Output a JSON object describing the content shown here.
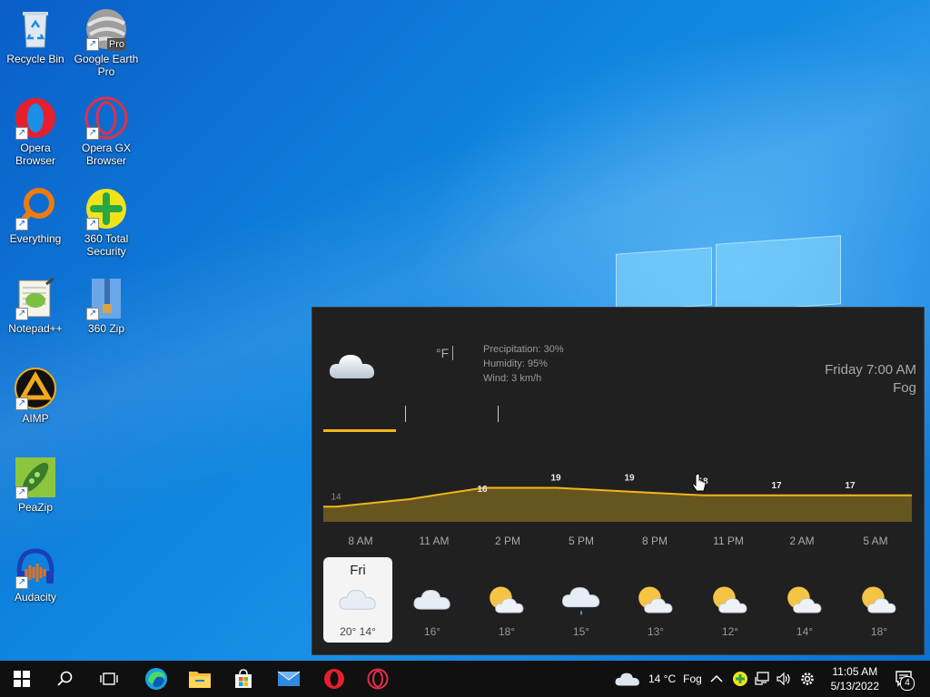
{
  "desktop": {
    "icons": [
      {
        "label": "Recycle Bin"
      },
      {
        "label": "Google Earth Pro",
        "badge": "Pro"
      },
      {
        "label": "Opera Browser"
      },
      {
        "label": "Opera GX Browser"
      },
      {
        "label": "Everything"
      },
      {
        "label": "360 Total Security"
      },
      {
        "label": "Notepad++"
      },
      {
        "label": "360 Zip"
      },
      {
        "label": "AIMP"
      },
      {
        "label": "PeaZip"
      },
      {
        "label": "Audacity"
      }
    ]
  },
  "weather": {
    "unit": "°F",
    "precipitation": "Precipitation: 30%",
    "humidity": "Humidity: 95%",
    "wind": "Wind: 3 km/h",
    "day_time": "Friday 7:00 AM",
    "condition": "Fog",
    "hourly_labels": [
      "8 AM",
      "11 AM",
      "2 PM",
      "5 PM",
      "8 PM",
      "11 PM",
      "2 AM",
      "5 AM"
    ],
    "hourly_values": [
      "14",
      "16",
      "19",
      "19",
      "18",
      "17",
      "17",
      "17"
    ],
    "days": [
      {
        "name": "Fri",
        "temp": "20°  14°",
        "icon": "cloudy-icon"
      },
      {
        "name": "",
        "temp": "16°",
        "icon": "cloudy-icon"
      },
      {
        "name": "",
        "temp": "18°",
        "icon": "partly-sunny-icon"
      },
      {
        "name": "",
        "temp": "15°",
        "icon": "rain-icon"
      },
      {
        "name": "",
        "temp": "13°",
        "icon": "partly-sunny-icon"
      },
      {
        "name": "",
        "temp": "12°",
        "icon": "partly-sunny-icon"
      },
      {
        "name": "",
        "temp": "14°",
        "icon": "partly-sunny-icon"
      },
      {
        "name": "",
        "temp": "18°",
        "icon": "partly-sunny-icon"
      }
    ],
    "accent_color": "#f2b61b"
  },
  "taskbar": {
    "weather_temp": "14 °C",
    "weather_cond": "Fog",
    "time": "11:05 AM",
    "date": "5/13/2022",
    "notification_count": "4"
  }
}
